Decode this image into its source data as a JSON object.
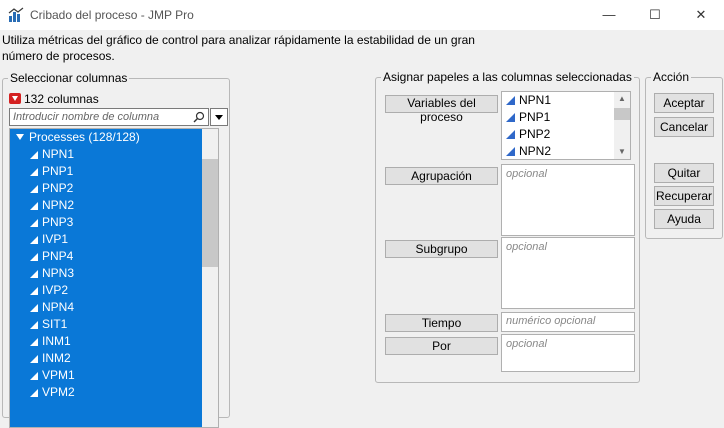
{
  "window": {
    "title": "Cribado del proceso - JMP Pro",
    "minimize": "—",
    "maximize": "☐",
    "close": "✕"
  },
  "description": "Utiliza métricas del gráfico de control para analizar rápidamente la estabilidad de un gran número de procesos.",
  "select_columns": {
    "legend": "Seleccionar columnas",
    "count": "132 columnas",
    "search_placeholder": "Introducir nombre de columna",
    "group_label": "Processes (128/128)",
    "items": [
      "NPN1",
      "PNP1",
      "PNP2",
      "NPN2",
      "PNP3",
      "IVP1",
      "PNP4",
      "NPN3",
      "IVP2",
      "NPN4",
      "SIT1",
      "INM1",
      "INM2",
      "VPM1",
      "VPM2"
    ]
  },
  "roles": {
    "legend": "Asignar papeles a las columnas seleccionadas",
    "process_vars_label": "Variables del proceso",
    "process_vars_items": [
      "NPN1",
      "PNP1",
      "PNP2",
      "NPN2"
    ],
    "grouping_label": "Agrupación",
    "grouping_placeholder": "opcional",
    "subgroup_label": "Subgrupo",
    "subgroup_placeholder": "opcional",
    "time_label": "Tiempo",
    "time_placeholder": "numérico opcional",
    "by_label": "Por",
    "by_placeholder": "opcional"
  },
  "actions": {
    "legend": "Acción",
    "ok": "Aceptar",
    "cancel": "Cancelar",
    "remove": "Quitar",
    "recall": "Recuperar",
    "help": "Ayuda"
  },
  "colors": {
    "selection": "#0a78d7",
    "column_icon": "#2f68c9",
    "red_arrow": "#d42020"
  }
}
